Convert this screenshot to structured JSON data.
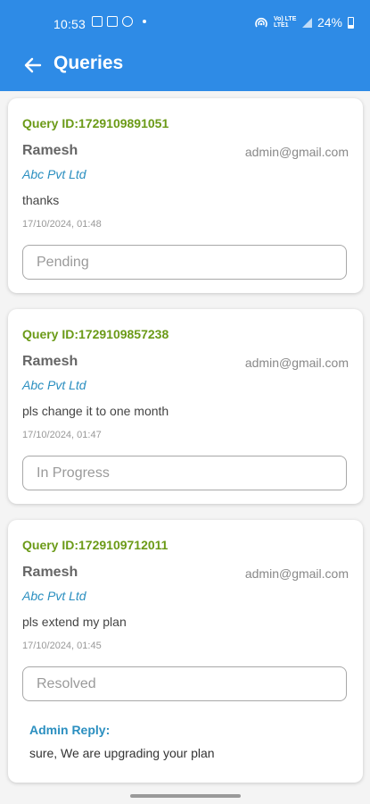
{
  "status_bar": {
    "time": "10:53",
    "network_label": "Vo) LTE LTE1",
    "battery": "24%"
  },
  "header": {
    "title": "Queries"
  },
  "queries": [
    {
      "id": "Query ID:1729109891051",
      "name": "Ramesh",
      "email": "admin@gmail.com",
      "company": "Abc Pvt Ltd",
      "message": "thanks",
      "datetime": "17/10/2024, 01:48",
      "status": "Pending"
    },
    {
      "id": "Query ID:1729109857238",
      "name": "Ramesh",
      "email": "admin@gmail.com",
      "company": "Abc Pvt Ltd",
      "message": "pls change it to one month",
      "datetime": "17/10/2024, 01:47",
      "status": "In Progress"
    },
    {
      "id": "Query ID:1729109712011",
      "name": "Ramesh",
      "email": "admin@gmail.com",
      "company": "Abc Pvt Ltd",
      "message": "pls extend my plan",
      "datetime": "17/10/2024, 01:45",
      "status": "Resolved",
      "admin_reply_label": "Admin Reply:",
      "admin_reply": "sure, We are upgrading your plan"
    }
  ],
  "colors": {
    "app_bar": "#2e8be6",
    "query_id": "#6b9a17",
    "company": "#2b8fc0",
    "admin_reply_label": "#2b8fc0"
  }
}
